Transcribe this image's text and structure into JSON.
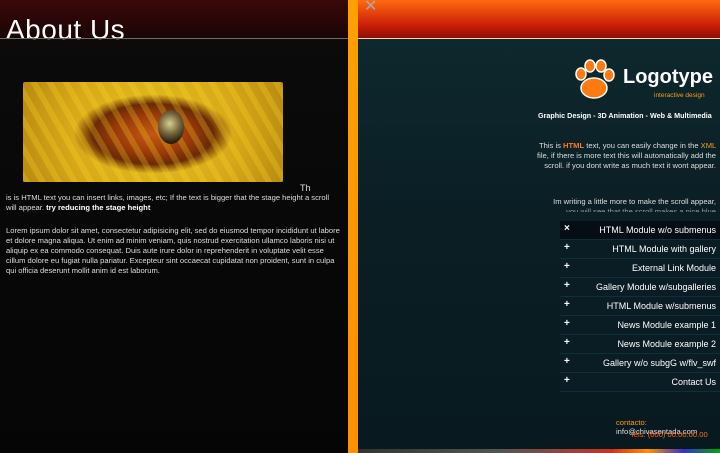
{
  "left": {
    "title": "About Us",
    "overflow_text": "Th",
    "intro_text": "is is HTML text you can insert links, images, etc; If the text is bigger that the stage height a scroll will appear.",
    "intro_bold": "try reducing the stage height",
    "lorem": "Lorem ipsum dolor sit amet, consectetur adipisicing elit, sed do eiusmod tempor incididunt ut labore et dolore magna aliqua. Ut enim ad minim veniam, quis nostrud exercitation ullamco laboris nisi ut aliquip ex ea commodo consequat. Duis aute irure dolor in reprehenderit in voluptate velit esse cillum dolore eu fugiat nulla pariatur. Excepteur sint occaecat cupidatat non proident, sunt in culpa qui officia deserunt mollit anim id est laborum."
  },
  "window": {
    "close_glyph": "✕"
  },
  "brand": {
    "logo_text": "Logotype",
    "logo_sub": "interactive design",
    "tagline": "Graphic Design - 3D Animation - Web & Multimedia",
    "accent": "#ff9c1a",
    "highlight": "#ff7a20"
  },
  "desc": {
    "p1_a": "This is ",
    "p1_html": "HTML",
    "p1_b": " text, you can easily change in the ",
    "p1_xml": "XML",
    "p1_c": " file, if there is more text this will automatically add the scroll. if you dont write as much text it wont appear.",
    "p2": "Im writing a little more to make the scroll appear,",
    "p2_cut": "you will see that the scroll makes a nice blue"
  },
  "menu": {
    "items": [
      {
        "label": "HTML Module w/o submenus",
        "icon": "×",
        "active": true
      },
      {
        "label": "HTML Module with gallery",
        "icon": "+"
      },
      {
        "label": "External Link Module",
        "icon": "+"
      },
      {
        "label": "Gallery Module w/subgalleries",
        "icon": "+"
      },
      {
        "label": "HTML Module w/submenus",
        "icon": "+"
      },
      {
        "label": "News Module example 1",
        "icon": "+"
      },
      {
        "label": "News Module example 2",
        "icon": "+"
      },
      {
        "label": "Gallery w/o subgG w/flv_swf",
        "icon": "+"
      },
      {
        "label": "Contact Us",
        "icon": "+"
      }
    ]
  },
  "contact": {
    "label": "contacto:",
    "email": "info@chivasentada.com",
    "phone": "Tels: (000) 00.00.00.00"
  }
}
